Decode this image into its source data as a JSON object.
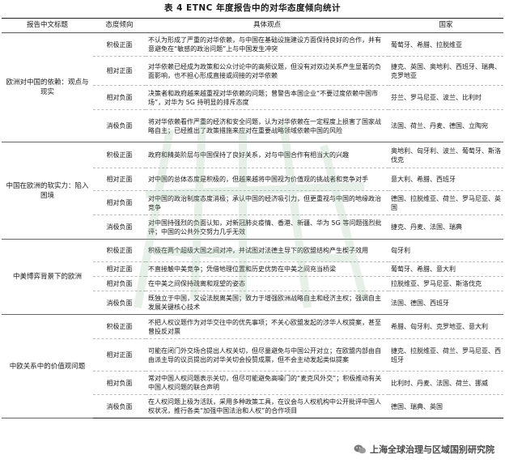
{
  "caption": "表 4 ETNC 年度报告中的对华态度倾向统计",
  "headers": [
    "报告中文标题",
    "态度倾向",
    "具体观点",
    "国家"
  ],
  "groups": [
    {
      "title": "欧洲对中国的依赖：观点与现实",
      "rows": [
        {
          "attitude": "积极正面",
          "view": "不认为形成了严重的对华依赖，与中国在基础设施建设方面保持良好的合作，并有意避免在“敏感的政治问题”上与中国发生冲突",
          "countries": "葡萄牙、希腊、拉脱维亚"
        },
        {
          "attitude": "相对正面",
          "view": "对华依赖已经成为政策和公众讨论中的高频议题，但没有对双边关系产生显著的负面影响，也不担心形成直接或间接的对华依赖",
          "countries": "捷克、英国、奥地利、西班牙、瑞典、克罗地亚"
        },
        {
          "attitude": "相对负面",
          "view": "决策者和政府越来越重视对华依赖的问题；曾警告本国企业“不要过度依赖中国市场”，对华为 5G 持明显的排斥态度",
          "countries": "芬兰、罗马尼亚、波兰、比利时"
        },
        {
          "attitude": "消极负面",
          "view": "将对华依赖看作严重的经济和安全问题，认为对华依赖在一定程度上损害了国家战略自主；已经推出了政策措施来应对在重要战略领域依赖中国的风险",
          "countries": "法国、荷兰、丹麦、德国、立陶宛"
        }
      ]
    },
    {
      "title": "中国在欧洲的软实力：陷入困境",
      "rows": [
        {
          "attitude": "积极正面",
          "view": "政府和精英阶层与中国保持了良好关系，对与中国合作有相当大的兴趣",
          "countries": "奥地利、匈牙利、波兰、葡萄牙、斯洛伐克"
        },
        {
          "attitude": "相对正面",
          "view": "对中国的总体态度是积极的，但越来越将中国视为价值观的挑战者和竞争对手",
          "countries": "意大利、希腊、西班牙"
        },
        {
          "attitude": "相对负面",
          "view": "对中国的政治制度态度消极；承认中国的经济吸引力，但更重视与中国的地缘政治竞争",
          "countries": "德国、拉脱维亚、荷兰、罗马尼亚、英国"
        },
        {
          "attitude": "消极负面",
          "view": "对中国持强烈的负面认知，对新冠肺炎疫情、香港、新疆、华为 5G 等问题强烈批评；中国的公共外交努力几乎无效",
          "countries": "捷克、丹麦、法国、瑞典"
        }
      ]
    },
    {
      "title": "中美博弈背景下的欧洲",
      "rows": [
        {
          "attitude": "积极正面",
          "view": "积极在两个超级大国之间对冲，并试图对法德主导下的欧盟结构产生楔子效用",
          "countries": "匈牙利"
        },
        {
          "attitude": "相对正面",
          "view": "不直接触中美竞争；凭借地理位置和历史优势在中美之间充当桥梁",
          "countries": "葡萄牙、希腊、意大利"
        },
        {
          "attitude": "相对负面",
          "view": "在中美之间保持疏离和观望的姿态",
          "countries": "拉脱维亚、罗马尼亚、斯洛伐克"
        },
        {
          "attitude": "消极负面",
          "view": "既独立于中国，又设法脱离美国；致力于增强欧洲战略自主和经济主权；强调自主发展关键核心技术",
          "countries": "法国、德国、西班牙"
        }
      ]
    },
    {
      "title": "中欧关系中的价值观问题",
      "rows": [
        {
          "attitude": "积极正面",
          "view": "不把人权议题作为对华交往中的优先事项；不关心欧盟发起的涉华人权提案，甚至曾投反对票",
          "countries": "希腊、匈牙利、克罗地亚、意大利"
        },
        {
          "attitude": "相对正面",
          "view": "可能在闭门外交场合提出人权关切，但尽量避免与中国公开对立；在欧盟内部由自由派主导的议员提出的对华关切会投赞成票，但不会主动发起类似提案",
          "countries": "捷克、拉脱维亚、荷兰、罗马尼亚、西班牙"
        },
        {
          "attitude": "相对负面",
          "view": "常对中国人权问题表示关切，但尽可能避免高噪门的“麦克风外交”；积极推动有关中国人权问题的联合声明",
          "countries": "比利时、丹麦、法国、荷兰、挪威"
        },
        {
          "attitude": "消极负面",
          "view": "在人权问题上极为活跃，采用多种政策工具，在议会与人权机构中公开批评中国人权状况，推行各类“加强中国法治和人权”的合作项目",
          "countries": "德国、瑞典、英国"
        }
      ]
    }
  ],
  "watermark": "上海全球治理与区域国别研究院",
  "wechat_label": "上海全球治理与区域国别研究院",
  "icons": [
    "wechat-icon"
  ]
}
